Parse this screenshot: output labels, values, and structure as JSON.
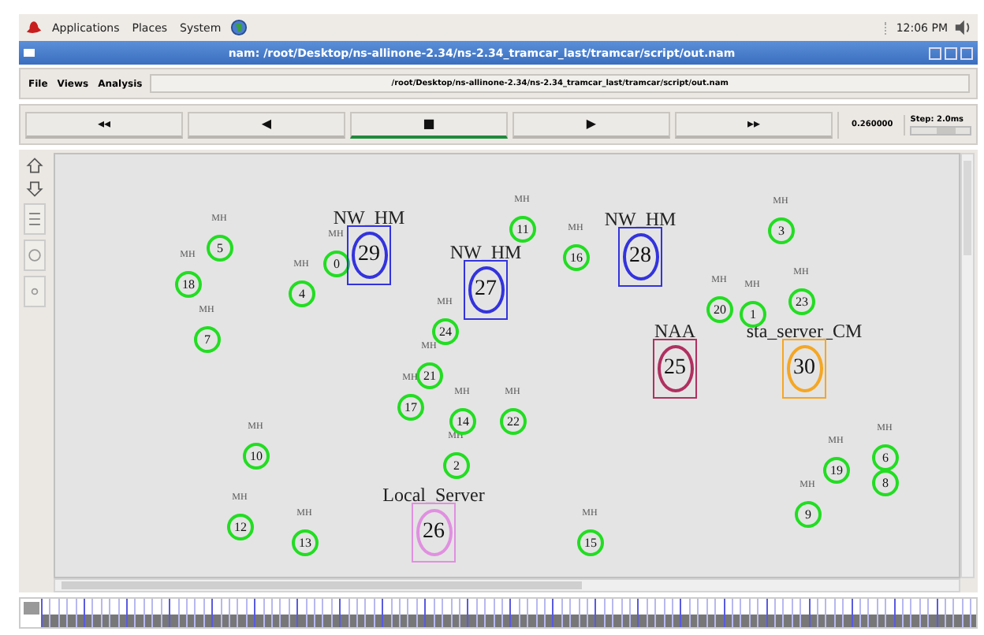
{
  "top_panel": {
    "menus": [
      "Applications",
      "Places",
      "System"
    ],
    "clock": "12:06 PM"
  },
  "window": {
    "title": "nam: /root/Desktop/ns-allinone-2.34/ns-2.34_tramcar_last/tramcar/script/out.nam"
  },
  "menu_bar": {
    "menus": [
      "File",
      "Views",
      "Analysis"
    ],
    "path": "/root/Desktop/ns-allinone-2.34/ns-2.34_tramcar_last/tramcar/script/out.nam"
  },
  "playback": {
    "buttons": [
      {
        "symbol": "◂◂",
        "selected": false
      },
      {
        "symbol": "◀",
        "selected": false
      },
      {
        "symbol": "■",
        "selected": true
      },
      {
        "symbol": "▶",
        "selected": false
      },
      {
        "symbol": "▸▸",
        "selected": false
      }
    ],
    "time": "0.260000",
    "step": "Step: 2.0ms",
    "slider": {
      "level": 0.6
    }
  },
  "nodes": [
    {
      "kind": "mobile",
      "label": "5",
      "tag": "MH",
      "color": "#22dd22"
    },
    {
      "kind": "mobile",
      "label": "0",
      "tag": "MH",
      "color": "#22dd22"
    },
    {
      "kind": "station",
      "label": "29",
      "caption": "NW_HM",
      "color": "#3333dd"
    },
    {
      "kind": "mobile",
      "label": "11",
      "tag": "MH",
      "color": "#22dd22"
    },
    {
      "kind": "mobile",
      "label": "16",
      "tag": "MH",
      "color": "#22dd22"
    },
    {
      "kind": "station",
      "label": "28",
      "caption": "NW_HM",
      "color": "#3333dd"
    },
    {
      "kind": "mobile",
      "label": "3",
      "tag": "MH",
      "color": "#22dd22"
    },
    {
      "kind": "mobile",
      "label": "18",
      "tag": "MH",
      "color": "#22dd22"
    },
    {
      "kind": "mobile",
      "label": "4",
      "tag": "MH",
      "color": "#22dd22"
    },
    {
      "kind": "station",
      "label": "27",
      "caption": "NW_HM",
      "color": "#3333dd"
    },
    {
      "kind": "mobile",
      "label": "20",
      "tag": "MH",
      "color": "#22dd22"
    },
    {
      "kind": "mobile",
      "label": "1",
      "tag": "MH",
      "color": "#22dd22"
    },
    {
      "kind": "mobile",
      "label": "23",
      "tag": "MH",
      "color": "#22dd22"
    },
    {
      "kind": "mobile",
      "label": "7",
      "tag": "MH",
      "color": "#22dd22"
    },
    {
      "kind": "mobile",
      "label": "21",
      "tag": "MH",
      "color": "#22dd22"
    },
    {
      "kind": "mobile",
      "label": "24",
      "tag": "MH",
      "color": "#22dd22"
    },
    {
      "kind": "station",
      "label": "25",
      "caption": "NAA",
      "color": "#b03060"
    },
    {
      "kind": "station",
      "label": "30",
      "caption": "sta_server_CM",
      "color": "#f5a623"
    },
    {
      "kind": "mobile",
      "label": "10",
      "tag": "MH",
      "color": "#22dd22"
    },
    {
      "kind": "mobile",
      "label": "17",
      "tag": "MH",
      "color": "#22dd22"
    },
    {
      "kind": "mobile",
      "label": "2",
      "tag": "MH",
      "color": "#22dd22"
    },
    {
      "kind": "mobile",
      "label": "14",
      "tag": "MH",
      "color": "#22dd22"
    },
    {
      "kind": "mobile",
      "label": "22",
      "tag": "MH",
      "color": "#22dd22"
    },
    {
      "kind": "mobile",
      "label": "19",
      "tag": "MH",
      "color": "#22dd22"
    },
    {
      "kind": "mobile",
      "label": "6",
      "tag": "MH",
      "color": "#22dd22"
    },
    {
      "kind": "mobile",
      "label": "8",
      "color": "#22dd22"
    },
    {
      "kind": "mobile",
      "label": "12",
      "tag": "MH",
      "color": "#22dd22"
    },
    {
      "kind": "mobile",
      "label": "13",
      "tag": "MH",
      "color": "#22dd22"
    },
    {
      "kind": "station",
      "label": "26",
      "caption": "Local_Server",
      "color": "#e090e0"
    },
    {
      "kind": "mobile",
      "label": "15",
      "tag": "MH",
      "color": "#22dd22"
    },
    {
      "kind": "mobile",
      "label": "9",
      "tag": "MH",
      "color": "#22dd22"
    }
  ]
}
